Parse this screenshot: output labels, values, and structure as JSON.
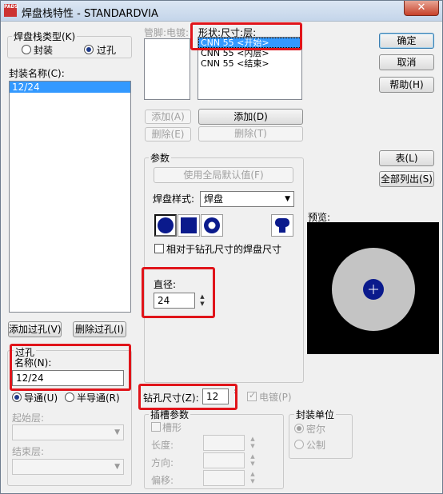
{
  "window": {
    "title": "焊盘栈特性 - STANDARDVIA",
    "app_icon": "PADS",
    "close_glyph": "✕"
  },
  "pad_stack_type": {
    "title": "焊盘栈类型(K)",
    "options": [
      {
        "label": "封装",
        "selected": false
      },
      {
        "label": "过孔",
        "selected": true
      }
    ]
  },
  "package_name": {
    "label": "封装名称(C):",
    "items": [
      "12/24"
    ]
  },
  "buttons": {
    "add_via": "添加过孔(V)",
    "delete_via": "删除过孔(I)",
    "ok": "确定",
    "cancel": "取消",
    "help": "帮助(H)",
    "table": "表(L)",
    "list_all": "全部列出(S)",
    "add_pin": "添加(A)",
    "delete_pin": "删除(E)",
    "add_shape": "添加(D)",
    "delete_shape": "删除(T)",
    "use_global": "使用全局默认值(F)"
  },
  "via": {
    "title": "过孔",
    "name_label": "名称(N):",
    "name_value": "12/24"
  },
  "conduction": {
    "options": [
      {
        "label": "导通(U)",
        "selected": true
      },
      {
        "label": "半导通(R)",
        "selected": false
      }
    ]
  },
  "start_layer": {
    "label": "起始层:"
  },
  "end_layer": {
    "label": "结束层:"
  },
  "pin_electrical": {
    "label": "管脚:电镀:"
  },
  "shape_list": {
    "label": "形状:尺寸:层:",
    "items": [
      "CNN 55 <开始>",
      "CNN 55 <内层>",
      "CNN 55 <结束>"
    ]
  },
  "params": {
    "title": "参数",
    "pad_style_label": "焊盘样式:",
    "pad_style_value": "焊盘",
    "relative_drill_label": "相对于钻孔尺寸的焊盘尺寸",
    "diameter_label": "直径:",
    "diameter_value": "24",
    "shape_icons": [
      "round-pad-icon",
      "square-pad-icon",
      "annular-pad-icon",
      "custom-pad-icon"
    ]
  },
  "drill": {
    "label": "钻孔尺寸(Z):",
    "value": "12",
    "plated_label": "电镀(P)",
    "plated": true
  },
  "slot": {
    "title": "插槽参数",
    "slotted_label": "槽形",
    "length_label": "长度:",
    "direction_label": "方向:",
    "offset_label": "偏移:"
  },
  "units": {
    "title": "封装单位",
    "options": [
      {
        "label": "密尔",
        "selected": true
      },
      {
        "label": "公制",
        "selected": false
      }
    ]
  },
  "preview": {
    "label": "预览:"
  },
  "colors": {
    "highlight_red": "#e0141a",
    "pad_blue": "#0a1a8c",
    "selection_blue": "#3399ff",
    "preview_gray": "#c4c4c4"
  }
}
